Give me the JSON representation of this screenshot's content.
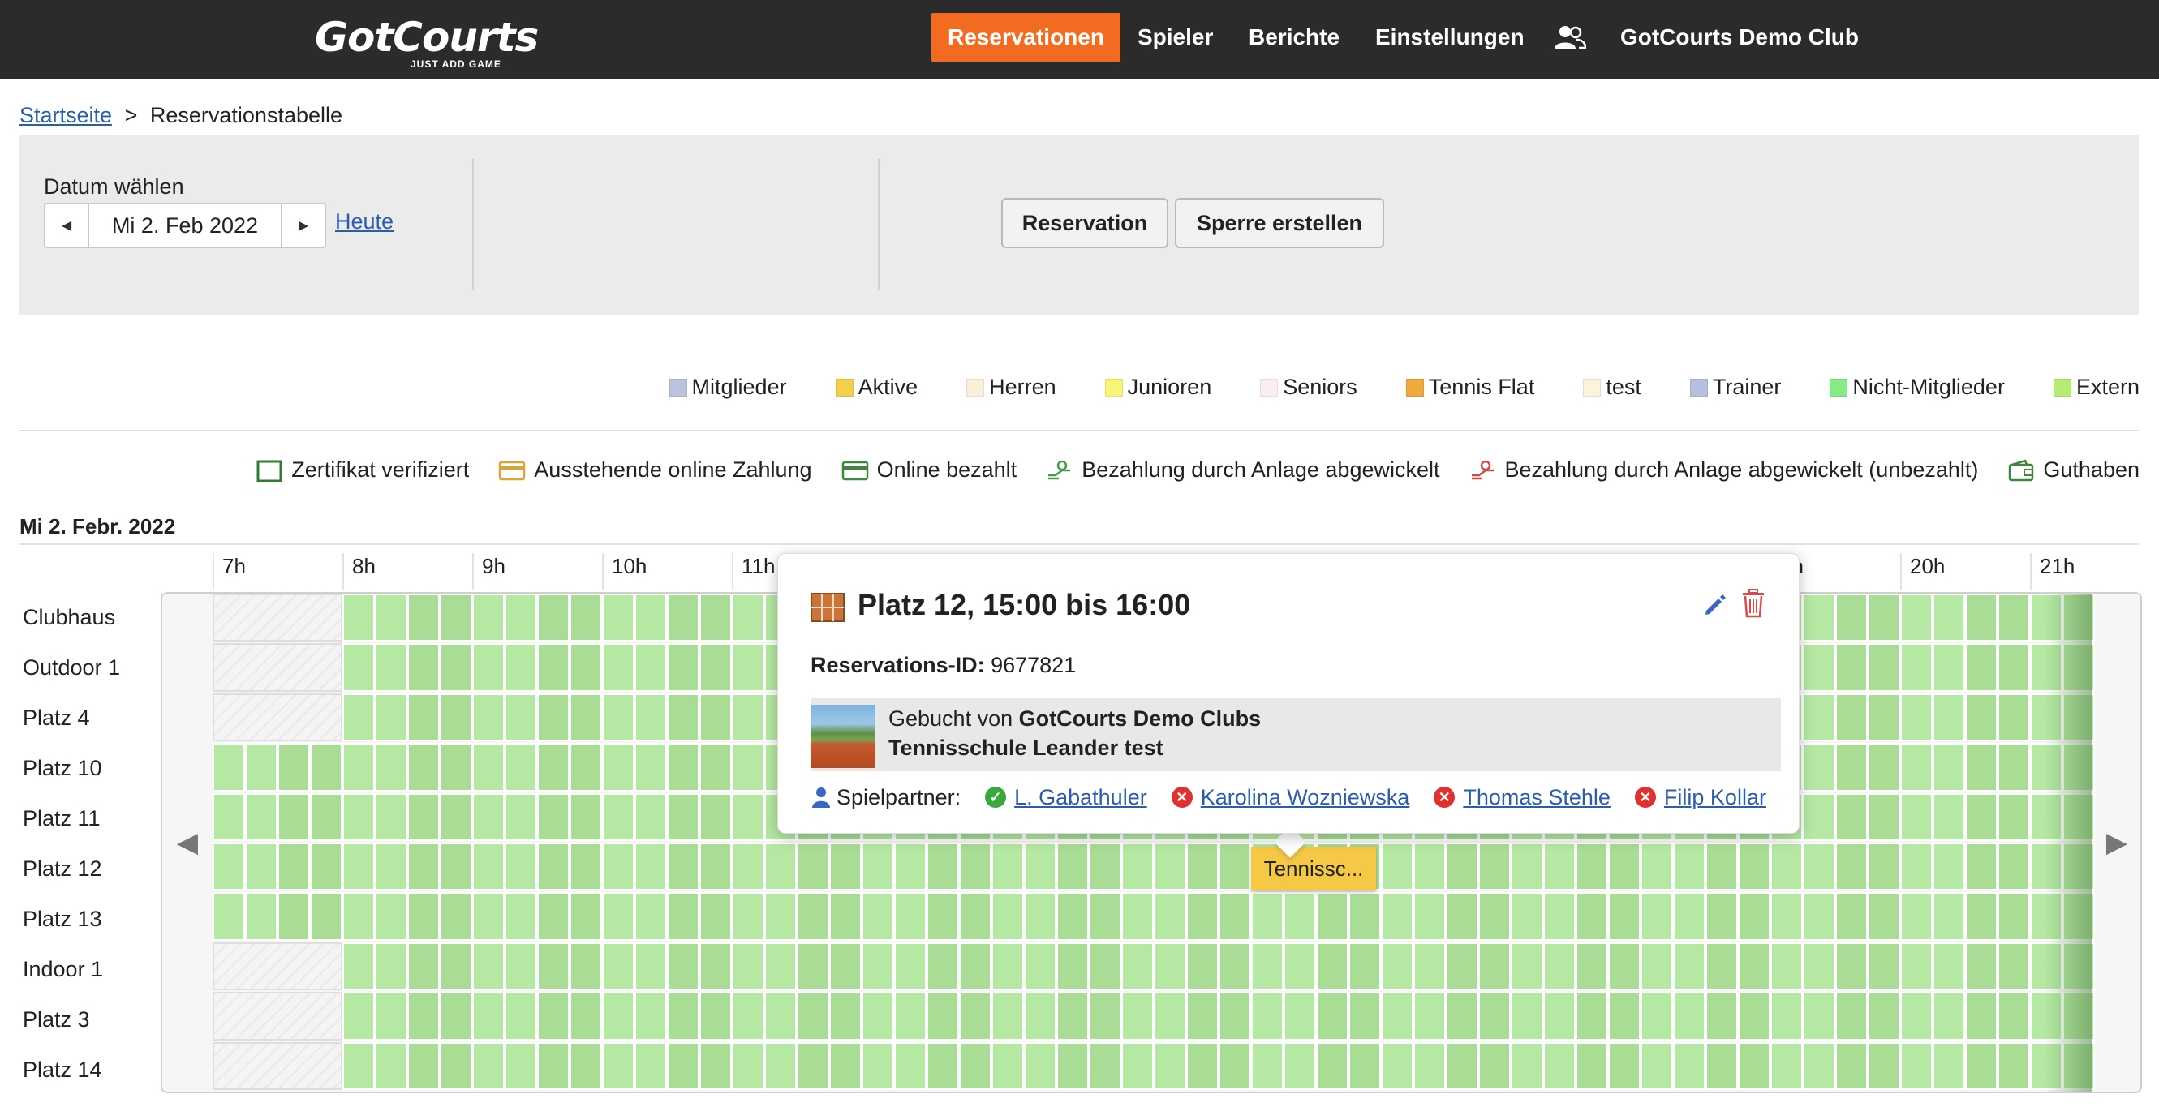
{
  "nav": {
    "logo_main": "GotCourts",
    "logo_tagline": "JUST ADD GAME",
    "items": [
      "Reservationen",
      "Spieler",
      "Berichte",
      "Einstellungen"
    ],
    "club": "GotCourts Demo Club"
  },
  "breadcrumb": {
    "home": "Startseite",
    "separator": ">",
    "current": "Reservationstabelle"
  },
  "filter": {
    "label": "Datum wählen",
    "date": "Mi 2. Feb 2022",
    "today": "Heute",
    "reservation_button": "Reservation",
    "block_button": "Sperre erstellen"
  },
  "legend_groups": [
    {
      "label": "Mitglieder",
      "color": "#b9c3dd"
    },
    {
      "label": "Aktive",
      "color": "#f4cf4a"
    },
    {
      "label": "Herren",
      "color": "#fbeedb"
    },
    {
      "label": "Junioren",
      "color": "#f8f478"
    },
    {
      "label": "Seniors",
      "color": "#f9eef1"
    },
    {
      "label": "Tennis Flat",
      "color": "#f2a93b"
    },
    {
      "label": "test",
      "color": "#fbf3da"
    },
    {
      "label": "Trainer",
      "color": "#b3c1de"
    },
    {
      "label": "Nicht-Mitglieder",
      "color": "#86ea86"
    },
    {
      "label": "Extern",
      "color": "#b6ec72"
    }
  ],
  "legend_payment": [
    {
      "label": "Zertifikat verifiziert",
      "icon": "certificate-icon"
    },
    {
      "label": "Ausstehende online Zahlung",
      "icon": "pending-card-icon"
    },
    {
      "label": "Online bezahlt",
      "icon": "paid-card-icon"
    },
    {
      "label": "Bezahlung durch Anlage abgewickelt",
      "icon": "facility-paid-icon"
    },
    {
      "label": "Bezahlung durch Anlage abgewickelt (unbezahlt)",
      "icon": "facility-unpaid-icon"
    },
    {
      "label": "Guthaben",
      "icon": "wallet-icon"
    }
  ],
  "schedule": {
    "day_title": "Mi 2. Febr. 2022",
    "hours": [
      "7h",
      "8h",
      "9h",
      "10h",
      "11h",
      "20h",
      "21h"
    ],
    "partial_hour": "0h",
    "courts": [
      "Clubhaus",
      "Outdoor 1",
      "Platz 4",
      "Platz 10",
      "Platz 11",
      "Platz 12",
      "Platz 13",
      "Indoor 1",
      "Platz 3",
      "Platz 14"
    ],
    "blocked_before_8": [
      "Clubhaus",
      "Outdoor 1",
      "Platz 4",
      "Indoor 1",
      "Platz 3",
      "Platz 14"
    ],
    "booking_badge": "Tennissc..."
  },
  "popover": {
    "title": "Platz 12, 15:00 bis 16:00",
    "res_id_label": "Reservations-ID:",
    "res_id": "9677821",
    "booked_by_prefix": "Gebucht von",
    "booked_by": "GotCourts Demo Clubs",
    "booked_line2": "Tennisschule Leander test",
    "partners_label": "Spielpartner:",
    "partners": [
      {
        "name": "L. Gabathuler",
        "status": "confirmed"
      },
      {
        "name": "Karolina Wozniewska",
        "status": "declined"
      },
      {
        "name": "Thomas Stehle",
        "status": "declined"
      },
      {
        "name": "Filip Kollar",
        "status": "declined"
      }
    ]
  }
}
